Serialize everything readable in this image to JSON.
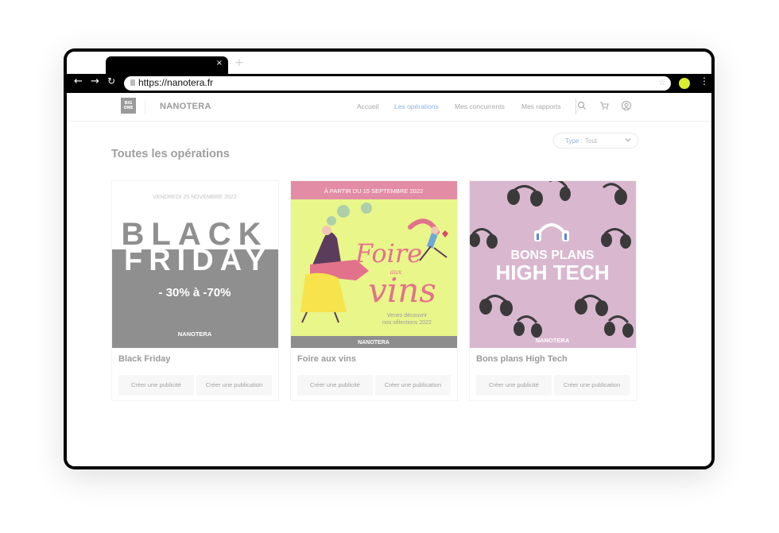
{
  "browser": {
    "tab_close": "×",
    "new_tab": "+",
    "url": "https://nanotera.fr",
    "accent": "#d9ee2c"
  },
  "site": {
    "brand": "NANOTERA",
    "logo_text": "BIG ONE",
    "nav": [
      "Accueil",
      "Les opérations",
      "Mes concurrents",
      "Mes rapports"
    ],
    "active_nav": "Les opérations",
    "filter": {
      "label": "Type :",
      "value": "Tout"
    },
    "page_title": "Toutes les opérations"
  },
  "cards": [
    {
      "title": "Black Friday",
      "banner": {
        "date": "VENDREDI 25 NOVEMBRE 2022",
        "line1": "BLACK",
        "line2": "FRIDAY",
        "discount": "- 30% à -70%",
        "brand": "NANOTERA"
      },
      "buttons": [
        "Créer une publicité",
        "Créer une publication"
      ]
    },
    {
      "title": "Foire aux vins",
      "banner": {
        "date": "À PARTIR DU 15 SEPTEMBRE 2022",
        "word1": "Foire",
        "word2": "aux",
        "word3": "vins",
        "tagline1": "Venez découvrir",
        "tagline2": "nos sélections 2022",
        "brand": "NANOTERA"
      },
      "buttons": [
        "Créer une publicité",
        "Créer une publication"
      ]
    },
    {
      "title": "Bons plans High Tech",
      "banner": {
        "line1": "BONS PLANS",
        "line2": "HIGH TECH",
        "brand": "NANOTERA"
      },
      "buttons": [
        "Créer une publicité",
        "Créer une publication"
      ]
    }
  ],
  "icons": [
    "back-icon",
    "forward-icon",
    "reload-icon",
    "lock-icon",
    "star-icon",
    "menu-icon",
    "search-icon",
    "cart-icon",
    "account-icon",
    "chevron-down-icon"
  ]
}
